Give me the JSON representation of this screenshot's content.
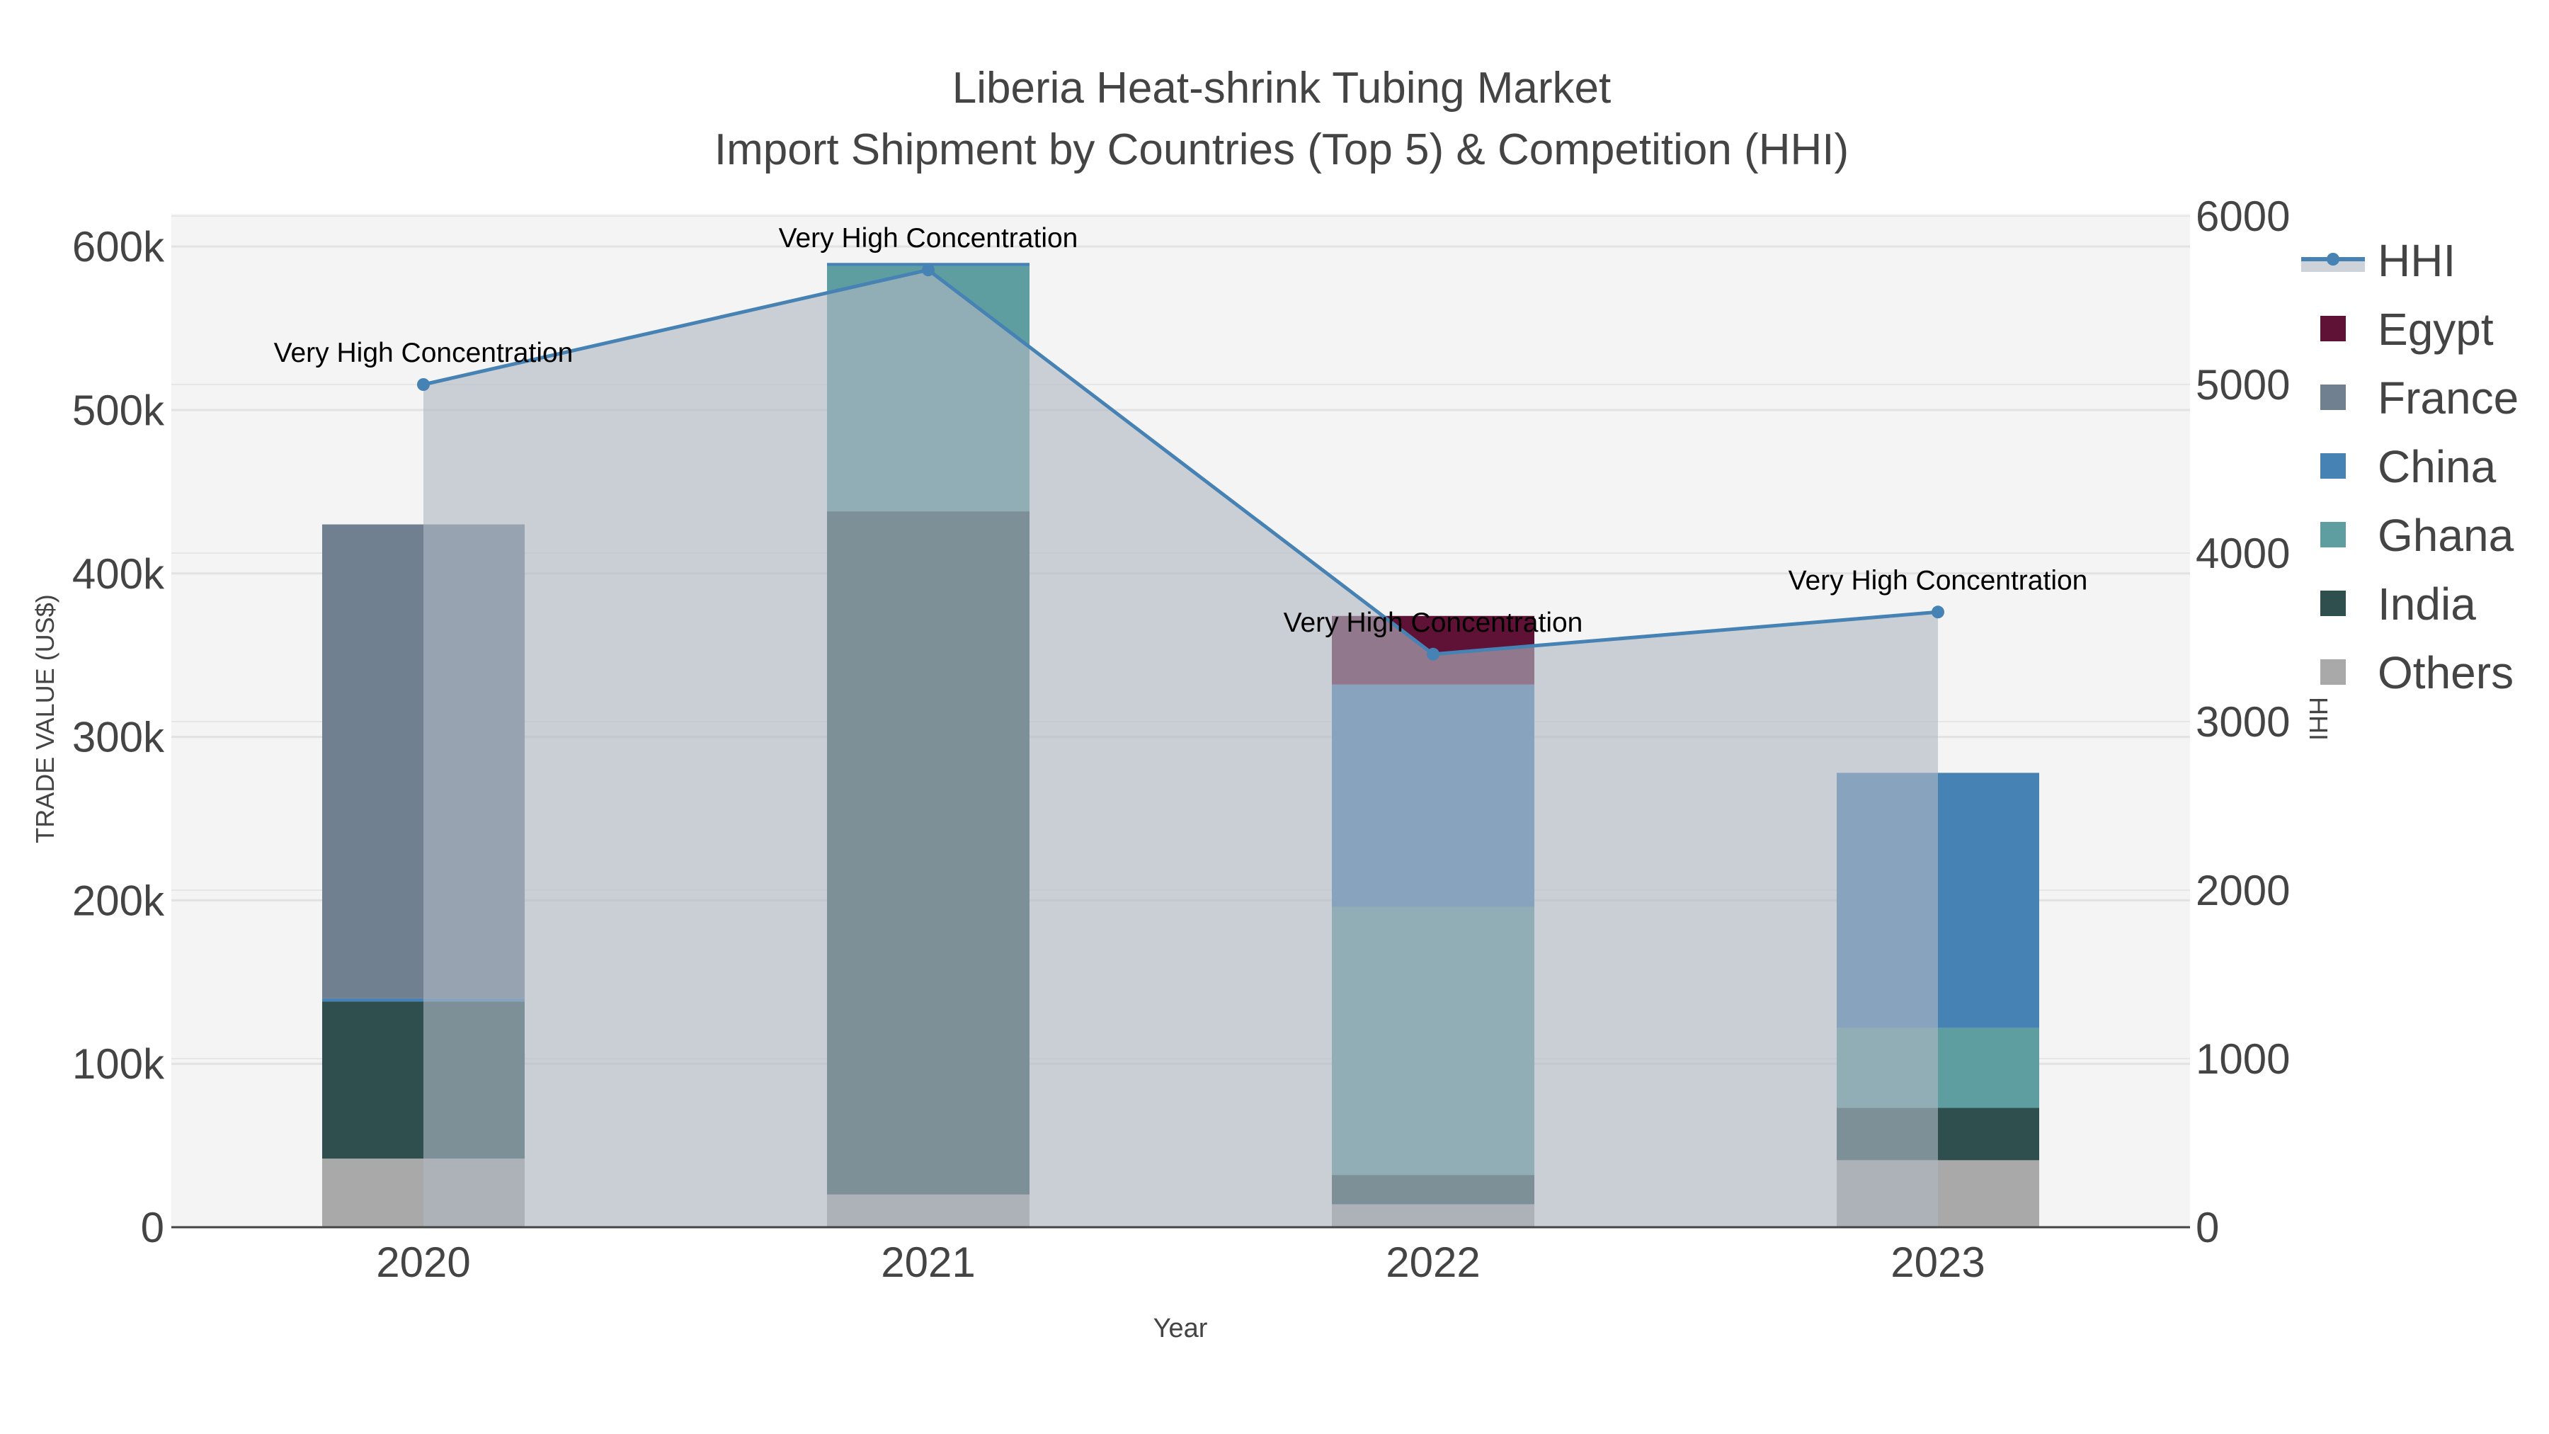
{
  "chart_data": {
    "type": "bar",
    "stacked": true,
    "title": "Liberia Heat-shrink Tubing Market",
    "subtitle": "Import Shipment by Countries (Top 5) & Competition (HHI)",
    "xlabel": "Year",
    "ylabel": "TRADE VALUE (US$)",
    "y2label": "HHI",
    "categories": [
      "2020",
      "2021",
      "2022",
      "2023"
    ],
    "ylim": [
      0,
      620000
    ],
    "y_ticks": [
      0,
      100000,
      200000,
      300000,
      400000,
      500000,
      600000
    ],
    "y_tick_labels": [
      "0",
      "100k",
      "200k",
      "300k",
      "400k",
      "500k",
      "600k"
    ],
    "y2lim": [
      0,
      6000
    ],
    "y2_ticks": [
      0,
      1000,
      2000,
      3000,
      4000,
      5000,
      6000
    ],
    "y2_tick_labels": [
      "0",
      "1000",
      "2000",
      "3000",
      "4000",
      "5000",
      "6000"
    ],
    "grid": true,
    "legend_position": "right",
    "series": [
      {
        "name": "Others",
        "color": "#a9a9a9",
        "values": [
          42000,
          20000,
          14000,
          41000
        ]
      },
      {
        "name": "India",
        "color": "#2f4f4f",
        "values": [
          96000,
          418000,
          18000,
          32000
        ]
      },
      {
        "name": "Ghana",
        "color": "#5f9ea0",
        "values": [
          0,
          150000,
          164000,
          49000
        ]
      },
      {
        "name": "China",
        "color": "#4682b4",
        "values": [
          2000,
          2000,
          136000,
          156000
        ]
      },
      {
        "name": "France",
        "color": "#708090",
        "values": [
          290000,
          0,
          0,
          0
        ]
      },
      {
        "name": "Egypt",
        "color": "#5f1236",
        "values": [
          0,
          0,
          42000,
          0
        ]
      }
    ],
    "hhi": {
      "name": "HHI",
      "color": "#4682b4",
      "values": [
        5000,
        5680,
        3400,
        3650
      ],
      "annotations": [
        "Very High Concentration",
        "Very High Concentration",
        "Very High Concentration",
        "Very High Concentration"
      ]
    },
    "legend_order": [
      "HHI",
      "Egypt",
      "France",
      "China",
      "Ghana",
      "India",
      "Others"
    ]
  }
}
